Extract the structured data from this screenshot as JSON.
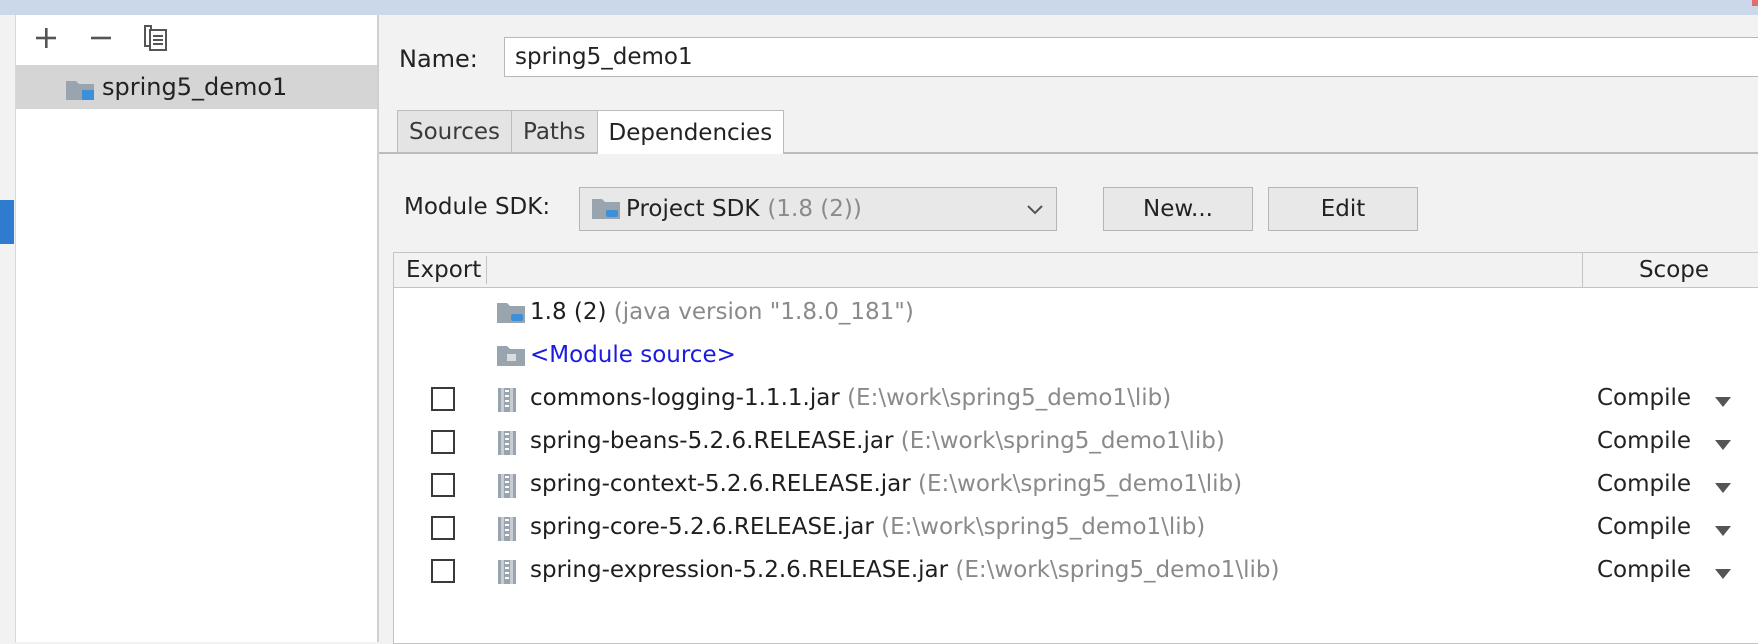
{
  "toolbar": {
    "add_icon": "plus-icon",
    "remove_icon": "minus-icon",
    "copy_icon": "copy-icon"
  },
  "modules": [
    {
      "label": "spring5_demo1",
      "icon": "module-folder-icon"
    }
  ],
  "name_field": {
    "label": "Name:",
    "value": "spring5_demo1"
  },
  "tabs": [
    {
      "label": "Sources",
      "active": false
    },
    {
      "label": "Paths",
      "active": false
    },
    {
      "label": "Dependencies",
      "active": true
    }
  ],
  "sdk": {
    "label": "Module SDK:",
    "selected": "Project SDK",
    "selected_detail": "(1.8 (2))",
    "new_button": "New...",
    "edit_button": "Edit"
  },
  "table": {
    "col_export": "Export",
    "col_scope": "Scope",
    "sdk_row": {
      "name": "1.8 (2)",
      "detail": "(java version \"1.8.0_181\")"
    },
    "source_row": {
      "name": "<Module source>"
    },
    "dependencies": [
      {
        "name": "commons-logging-1.1.1.jar",
        "path": "(E:\\work\\spring5_demo1\\lib)",
        "scope": "Compile",
        "exported": false
      },
      {
        "name": "spring-beans-5.2.6.RELEASE.jar",
        "path": "(E:\\work\\spring5_demo1\\lib)",
        "scope": "Compile",
        "exported": false
      },
      {
        "name": "spring-context-5.2.6.RELEASE.jar",
        "path": "(E:\\work\\spring5_demo1\\lib)",
        "scope": "Compile",
        "exported": false
      },
      {
        "name": "spring-core-5.2.6.RELEASE.jar",
        "path": "(E:\\work\\spring5_demo1\\lib)",
        "scope": "Compile",
        "exported": false
      },
      {
        "name": "spring-expression-5.2.6.RELEASE.jar",
        "path": "(E:\\work\\spring5_demo1\\lib)",
        "scope": "Compile",
        "exported": false
      }
    ]
  },
  "colors": {
    "link": "#1a1ae0",
    "dim_text": "#8a8a8a",
    "selection": "#d5d5d5",
    "accent": "#2f7bd0"
  }
}
